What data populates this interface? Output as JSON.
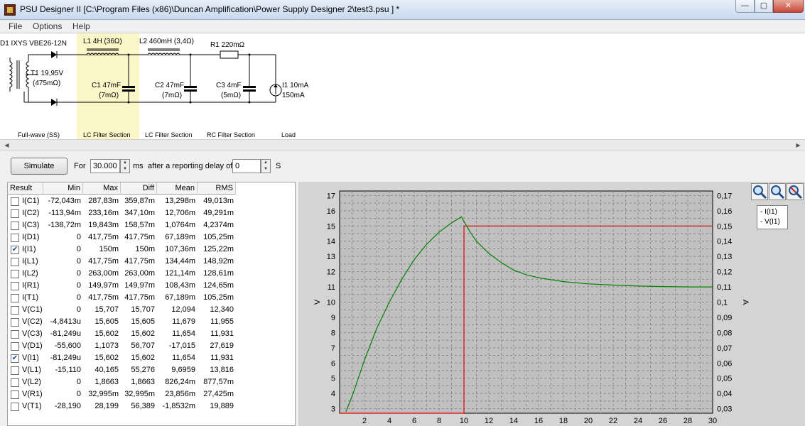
{
  "window": {
    "title": "PSU Designer II  [C:\\Program Files (x86)\\Duncan Amplification\\Power Supply Designer 2\\test3.psu ] *",
    "min_symbol": "—",
    "max_symbol": "▢",
    "close_symbol": "✕"
  },
  "menu": [
    "File",
    "Options",
    "Help"
  ],
  "schematic": {
    "labels": {
      "d1": "D1 IXYS  VBE26-12N",
      "t1": "T1 19,95V",
      "t1_r": "(475mΩ)",
      "l1": "L1 4H (36Ω)",
      "l2": "L2 460mH (3,4Ω)",
      "r1": "R1 220mΩ",
      "c1": "C1 47mF",
      "c1_r": "(7mΩ)",
      "c2": "C2 47mF",
      "c2_r": "(7mΩ)",
      "c3": "C3 4mF",
      "c3_r": "(5mΩ)",
      "i1": "I1 10mA",
      "i1_b": "150mA"
    },
    "sections": [
      "Full-wave (SS)",
      "LC Filter Section",
      "LC Filter Section",
      "RC Filter Section",
      "Load"
    ]
  },
  "controls": {
    "simulate_label": "Simulate",
    "for_label": "For",
    "duration_value": "30.000",
    "ms_label": "ms",
    "delay_label": "after a reporting delay of",
    "delay_value": "0",
    "s_label": "S"
  },
  "results": {
    "headers": [
      "Result",
      "Min",
      "Max",
      "Diff",
      "Mean",
      "RMS"
    ],
    "rows": [
      {
        "name": "I(C1)",
        "checked": false,
        "min": "-72,043m",
        "max": "287,83m",
        "diff": "359,87m",
        "mean": "13,298m",
        "rms": "49,013m"
      },
      {
        "name": "I(C2)",
        "checked": false,
        "min": "-113,94m",
        "max": "233,16m",
        "diff": "347,10m",
        "mean": "12,706m",
        "rms": "49,291m"
      },
      {
        "name": "I(C3)",
        "checked": false,
        "min": "-138,72m",
        "max": "19,843m",
        "diff": "158,57m",
        "mean": "1,0764m",
        "rms": "4,2374m"
      },
      {
        "name": "I(D1)",
        "checked": false,
        "min": "0",
        "max": "417,75m",
        "diff": "417,75m",
        "mean": "67,189m",
        "rms": "105,25m"
      },
      {
        "name": "I(I1)",
        "checked": true,
        "min": "0",
        "max": "150m",
        "diff": "150m",
        "mean": "107,36m",
        "rms": "125,22m"
      },
      {
        "name": "I(L1)",
        "checked": false,
        "min": "0",
        "max": "417,75m",
        "diff": "417,75m",
        "mean": "134,44m",
        "rms": "148,92m"
      },
      {
        "name": "I(L2)",
        "checked": false,
        "min": "0",
        "max": "263,00m",
        "diff": "263,00m",
        "mean": "121,14m",
        "rms": "128,61m"
      },
      {
        "name": "I(R1)",
        "checked": false,
        "min": "0",
        "max": "149,97m",
        "diff": "149,97m",
        "mean": "108,43m",
        "rms": "124,65m"
      },
      {
        "name": "I(T1)",
        "checked": false,
        "min": "0",
        "max": "417,75m",
        "diff": "417,75m",
        "mean": "67,189m",
        "rms": "105,25m"
      },
      {
        "name": "V(C1)",
        "checked": false,
        "min": "0",
        "max": "15,707",
        "diff": "15,707",
        "mean": "12,094",
        "rms": "12,340"
      },
      {
        "name": "V(C2)",
        "checked": false,
        "min": "-4,8413u",
        "max": "15,605",
        "diff": "15,605",
        "mean": "11,679",
        "rms": "11,955"
      },
      {
        "name": "V(C3)",
        "checked": false,
        "min": "-81,249u",
        "max": "15,602",
        "diff": "15,602",
        "mean": "11,654",
        "rms": "11,931"
      },
      {
        "name": "V(D1)",
        "checked": false,
        "min": "-55,600",
        "max": "1,1073",
        "diff": "56,707",
        "mean": "-17,015",
        "rms": "27,619"
      },
      {
        "name": "V(I1)",
        "checked": true,
        "min": "-81,249u",
        "max": "15,602",
        "diff": "15,602",
        "mean": "11,654",
        "rms": "11,931"
      },
      {
        "name": "V(L1)",
        "checked": false,
        "min": "-15,110",
        "max": "40,165",
        "diff": "55,276",
        "mean": "9,6959",
        "rms": "13,816"
      },
      {
        "name": "V(L2)",
        "checked": false,
        "min": "0",
        "max": "1,8663",
        "diff": "1,8663",
        "mean": "826,24m",
        "rms": "877,57m"
      },
      {
        "name": "V(R1)",
        "checked": false,
        "min": "0",
        "max": "32,995m",
        "diff": "32,995m",
        "mean": "23,856m",
        "rms": "27,425m"
      },
      {
        "name": "V(T1)",
        "checked": false,
        "min": "-28,190",
        "max": "28,199",
        "diff": "56,389",
        "mean": "-1,8532m",
        "rms": "19,889"
      }
    ]
  },
  "chart_data": {
    "type": "line",
    "x_ticks": [
      2,
      4,
      6,
      8,
      10,
      12,
      14,
      16,
      18,
      20,
      22,
      24,
      26,
      28,
      30
    ],
    "xlim": [
      0,
      30
    ],
    "y_left_ticks": [
      3,
      4,
      5,
      6,
      7,
      8,
      9,
      10,
      11,
      12,
      13,
      14,
      15,
      16,
      17
    ],
    "ylim_left": [
      2.7,
      17.3
    ],
    "ylabel_left": "V",
    "y_right_ticks": [
      "0,03",
      "0,04",
      "0,05",
      "0,06",
      "0,07",
      "0,08",
      "0,09",
      "0,1",
      "0,11",
      "0,12",
      "0,13",
      "0,14",
      "0,15",
      "0,16",
      "0,17"
    ],
    "ylim_right": [
      0.027,
      0.173
    ],
    "ylabel_right": "A",
    "grid": true,
    "legend_position": "top-right",
    "series": [
      {
        "name": "I(I1)",
        "axis": "right",
        "color": "#e00000",
        "x": [
          0,
          10,
          10,
          30
        ],
        "y": [
          0.027,
          0.027,
          0.15,
          0.15
        ]
      },
      {
        "name": "V(I1)",
        "axis": "left",
        "color": "#008000",
        "x": [
          0.5,
          1.0,
          1.5,
          2,
          3,
          4,
          5,
          6,
          7,
          8,
          9,
          9.8,
          10,
          10.5,
          11,
          12,
          13,
          14,
          15,
          16,
          18,
          20,
          22,
          24,
          26,
          28,
          30
        ],
        "y": [
          2.8,
          3.8,
          5.0,
          6.2,
          8.3,
          10.0,
          11.5,
          12.8,
          13.8,
          14.6,
          15.2,
          15.6,
          15.3,
          14.6,
          14.0,
          13.2,
          12.6,
          12.1,
          11.8,
          11.6,
          11.35,
          11.2,
          11.12,
          11.06,
          11.02,
          11.0,
          11.0
        ]
      }
    ]
  }
}
